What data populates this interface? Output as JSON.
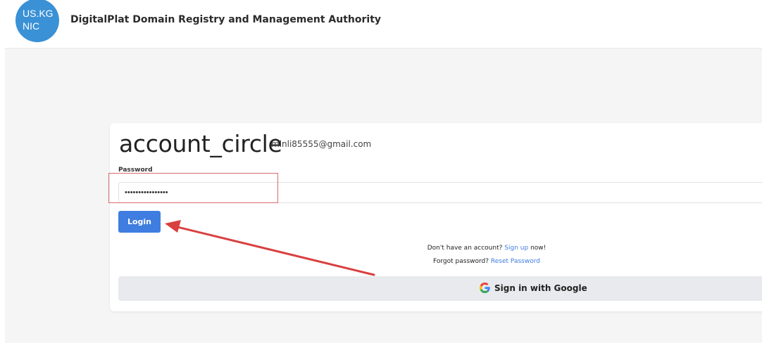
{
  "header": {
    "logo_line1": "US.KG",
    "logo_line2": "NIC",
    "title": "DigitalPlat Domain Registry and Management Authority"
  },
  "login": {
    "account_icon": "account_circle",
    "email": "mlnli85555@gmail.com",
    "password_label": "Password",
    "password_value": "••••••••••••••••",
    "login_button": "Login",
    "signup_prefix": "Don't have an account?",
    "signup_link": "Sign up",
    "signup_suffix": "now!",
    "forgot_prefix": "Forgot password?",
    "forgot_link": "Reset Password",
    "google_button": "Sign in with Google",
    "google_icon": "google-g-icon"
  },
  "colors": {
    "logo_bg": "#3a91d6",
    "primary": "#3f7de0",
    "annotation": "#d94040"
  }
}
